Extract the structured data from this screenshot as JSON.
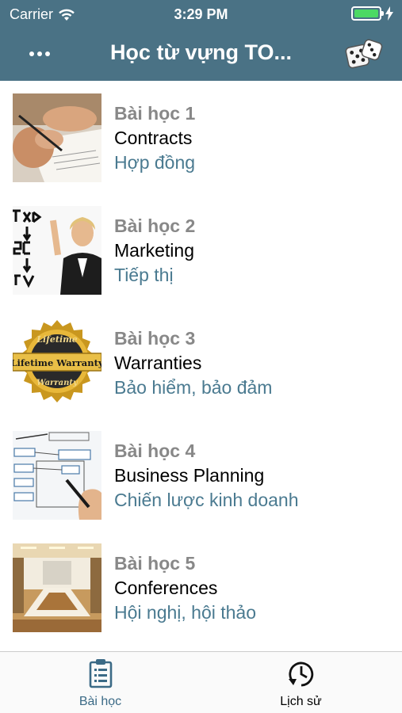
{
  "status": {
    "carrier": "Carrier",
    "time": "3:29 PM",
    "battery_level": 1.0,
    "battery_color": "#4cd964"
  },
  "navbar": {
    "title": "Học từ vựng TO...",
    "background": "#4a7285"
  },
  "lessons": [
    {
      "number": "Bài học 1",
      "title_en": "Contracts",
      "title_vi": "Hợp đồng",
      "image": "contract-signing-photo"
    },
    {
      "number": "Bài học 2",
      "title_en": "Marketing",
      "title_vi": "Tiếp thị",
      "image": "marketing-whiteboard-photo"
    },
    {
      "number": "Bài học 3",
      "title_en": "Warranties",
      "title_vi": "Bảo hiểm, bảo đảm",
      "image": "lifetime-warranty-seal"
    },
    {
      "number": "Bài học 4",
      "title_en": "Business Planning",
      "title_vi": "Chiến lược kinh doanh",
      "image": "strategy-flowchart-photo"
    },
    {
      "number": "Bài học 5",
      "title_en": "Conferences",
      "title_vi": "Hội nghị, hội thảo",
      "image": "conference-room-photo"
    }
  ],
  "seal_text": {
    "top": "Lifetime",
    "middle": "Lifetime Warranty",
    "bottom": "Warranty"
  },
  "tabs": [
    {
      "label": "Bài học",
      "icon": "clipboard-list-icon",
      "active": true
    },
    {
      "label": "Lịch sử",
      "icon": "history-clock-icon",
      "active": false
    }
  ],
  "colors": {
    "accent": "#3b6a86",
    "lesson_number": "#888888",
    "lesson_translation": "#4a7a90"
  }
}
